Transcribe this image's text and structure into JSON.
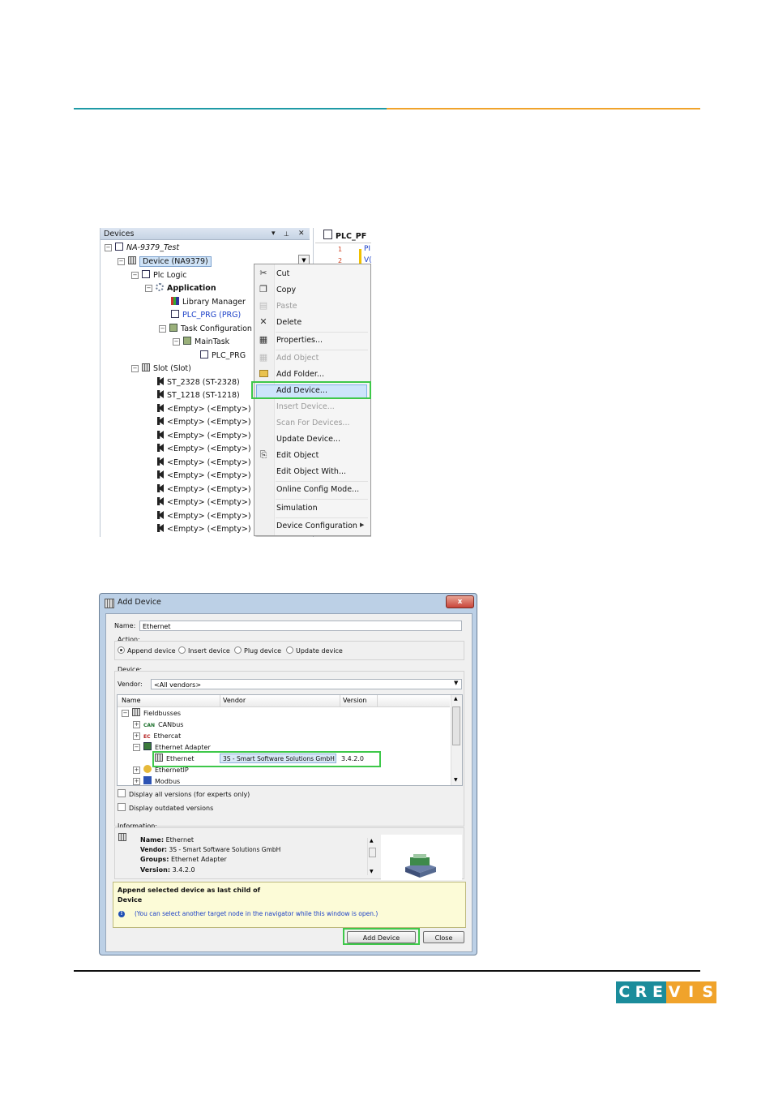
{
  "brand": {
    "logo_letters": [
      "C",
      "R",
      "E",
      "V",
      "I",
      "S"
    ],
    "teal": "#1b8c9b",
    "orange": "#f0a32b"
  },
  "devices_panel": {
    "title": "Devices",
    "controls": [
      "▾",
      "📌",
      "✕"
    ],
    "tree": {
      "project": "NA-9379_Test",
      "device": "Device (NA9379)",
      "plc_logic": "Plc Logic",
      "application": "Application",
      "library_manager": "Library Manager",
      "plc_prg": "PLC_PRG (PRG)",
      "task_configuration": "Task Configuration",
      "main_task": "MainTask",
      "task_plc_prg": "PLC_PRG",
      "slot": "Slot (Slot)",
      "slots": [
        "ST_2328 (ST-2328)",
        "ST_1218 (ST-1218)",
        "<Empty> (<Empty>)",
        "<Empty> (<Empty>)",
        "<Empty> (<Empty>)",
        "<Empty> (<Empty>)",
        "<Empty> (<Empty>)",
        "<Empty> (<Empty>)",
        "<Empty> (<Empty>)",
        "<Empty> (<Empty>)",
        "<Empty> (<Empty>)",
        "<Empty> (<Empty>)"
      ]
    }
  },
  "editor": {
    "tab": "PLC_PF",
    "lines": [
      "1",
      "2",
      "3"
    ],
    "text": [
      "PI",
      "V(",
      ""
    ]
  },
  "context_menu": {
    "items": [
      "Cut",
      "Copy",
      "Paste",
      "Delete",
      "Properties...",
      "Add Object",
      "Add Folder...",
      "Add Device...",
      "Insert Device...",
      "Scan For Devices...",
      "Update Device...",
      "Edit Object",
      "Edit Object With...",
      "Online Config Mode...",
      "Simulation",
      "Device Configuration"
    ],
    "disabled": [
      "Paste",
      "Add Object",
      "Insert Device...",
      "Scan For Devices..."
    ],
    "highlighted": "Add Device..."
  },
  "add_device_dialog": {
    "title": "Add Device",
    "close": "x",
    "name_label": "Name:",
    "name_value": "Ethernet",
    "action_label": "Action:",
    "actions": [
      "Append device",
      "Insert device",
      "Plug device",
      "Update device"
    ],
    "selected_action": "Append device",
    "device_label": "Device:",
    "vendor_label": "Vendor:",
    "vendor_value": "<All vendors>",
    "columns": [
      "Name",
      "Vendor",
      "Version"
    ],
    "rows": {
      "fieldbusses": "Fieldbusses",
      "canbus": "CANbus",
      "ethercat": "Ethercat",
      "ethernet_adapter": "Ethernet Adapter",
      "ethernet": "Ethernet",
      "ethernet_vendor": "3S - Smart Software Solutions GmbH",
      "ethernet_version": "3.4.2.0",
      "ethernetip": "EthernetIP",
      "modbus": "Modbus"
    },
    "check_all_versions": "Display all versions (for experts only)",
    "check_outdated": "Display outdated versions",
    "information_label": "Information:",
    "info": {
      "name_k": "Name:",
      "name_v": "Ethernet",
      "vendor_k": "Vendor:",
      "vendor_v": "3S - Smart Software Solutions GmbH",
      "groups_k": "Groups:",
      "groups_v": "Ethernet Adapter",
      "version_k": "Version:",
      "version_v": "3.4.2.0"
    },
    "hint_bold_1": "Append selected device as last child of",
    "hint_bold_2": "Device",
    "hint_note": "(You can select another target node in the navigator while this window is open.)",
    "btn_add": "Add Device",
    "btn_close": "Close"
  },
  "colors": {
    "highlight_green": "#3ec84a",
    "header_teal": "#1f9aa6",
    "header_orange": "#f0a32b"
  }
}
